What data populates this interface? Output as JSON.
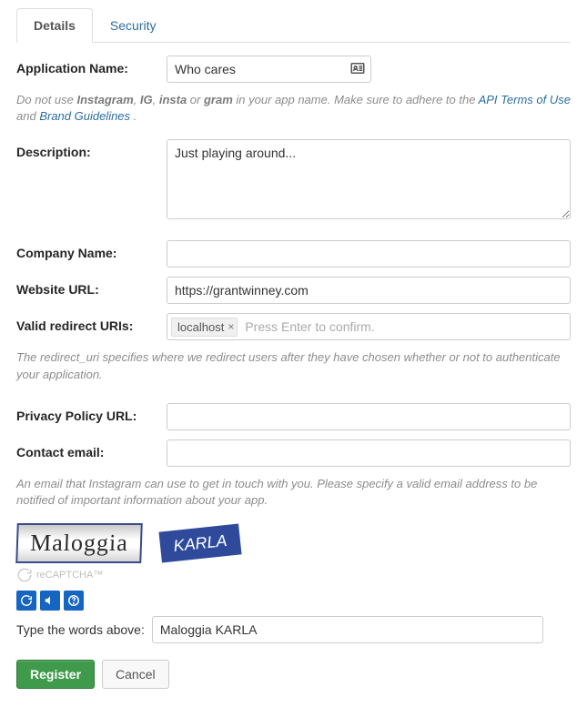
{
  "tabs": {
    "details": "Details",
    "security": "Security"
  },
  "labels": {
    "app_name": "Application Name:",
    "description": "Description:",
    "company": "Company Name:",
    "website": "Website URL:",
    "redirect": "Valid redirect URIs:",
    "privacy": "Privacy Policy URL:",
    "contact": "Contact email:",
    "captcha_prompt": "Type the words above:"
  },
  "values": {
    "app_name": "Who cares",
    "description": "Just playing around...",
    "company": "",
    "website": "https://grantwinney.com",
    "redirect_tag": "localhost",
    "redirect_placeholder": "Press Enter to confirm.",
    "privacy": "",
    "contact": "",
    "captcha_answer": "Maloggia KARLA"
  },
  "captcha": {
    "word1": "Maloggia",
    "word2": "KARLA",
    "badge": "reCAPTCHA™"
  },
  "helper": {
    "name_pre": "Do not use ",
    "b1": "Instagram",
    "sep1": ", ",
    "b2": "IG",
    "sep2": ", ",
    "b3": "insta",
    "sep3": " or ",
    "b4": "gram",
    "name_mid": " in your app name. Make sure to adhere to the ",
    "link1": "API Terms of Use",
    "and": " and ",
    "link2": "Brand Guidelines ",
    "dot": ".",
    "redirect": "The redirect_uri specifies where we redirect users after they have chosen whether or not to authenticate your application.",
    "contact": "An email that Instagram can use to get in touch with you. Please specify a valid email address to be notified of important information about your app."
  },
  "buttons": {
    "register": "Register",
    "cancel": "Cancel"
  }
}
